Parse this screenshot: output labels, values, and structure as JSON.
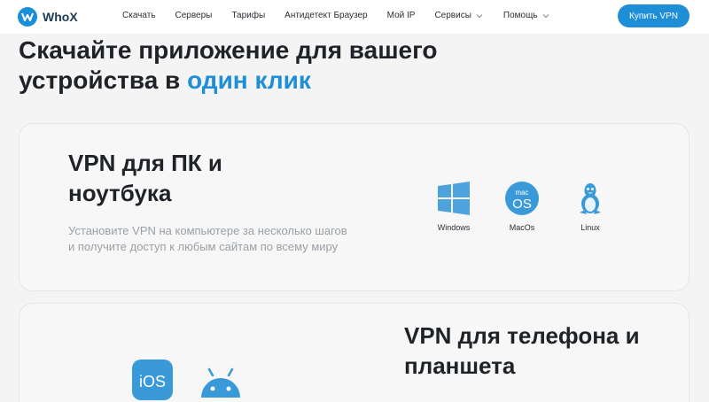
{
  "brand": {
    "name": "WhoX"
  },
  "nav": {
    "items": [
      {
        "label": "Скачать"
      },
      {
        "label": "Серверы"
      },
      {
        "label": "Тарифы"
      },
      {
        "label": "Антидетект Браузер"
      },
      {
        "label": "Мой IP"
      },
      {
        "label": "Сервисы"
      },
      {
        "label": "Помощь"
      }
    ],
    "buy_label": "Купить VPN"
  },
  "hero": {
    "title_part1": "Скачайте приложение для вашего устройства в",
    "title_accent": "один клик"
  },
  "pc_card": {
    "title": "VPN для ПК и ноутбука",
    "description": "Установите VPN на компьютере за несколько шагов и получите доступ к любым сайтам по всему миру",
    "platforms": [
      {
        "label": "Windows",
        "icon": "windows-icon"
      },
      {
        "label": "MacOs",
        "icon": "macos-icon"
      },
      {
        "label": "Linux",
        "icon": "linux-icon"
      }
    ]
  },
  "mobile_card": {
    "title": "VPN для телефона и планшета",
    "platforms": [
      {
        "label": "iOS",
        "icon": "ios-icon"
      },
      {
        "icon": "android-icon"
      }
    ]
  },
  "colors": {
    "accent": "#1e8fd6",
    "text": "#1f2327",
    "muted": "#9aa0a6"
  }
}
